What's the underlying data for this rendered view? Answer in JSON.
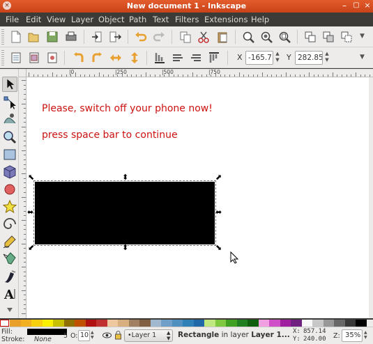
{
  "window": {
    "title": "New document 1 - Inkscape"
  },
  "menu": [
    "File",
    "Edit",
    "View",
    "Layer",
    "Object",
    "Path",
    "Text",
    "Filters",
    "Extensions",
    "Help"
  ],
  "controls": {
    "x_label": "X",
    "x_value": "-165.71",
    "y_label": "Y",
    "y_value": "282.857"
  },
  "ruler": {
    "h_labels": [
      "|0",
      "|250",
      "|500",
      "|750"
    ]
  },
  "canvas": {
    "line1": "Please, switch off your phone now!",
    "line2": "press space bar to continue",
    "text_color": "#cc1111"
  },
  "status": {
    "fill_label": "Fill:",
    "stroke_label": "Stroke:",
    "stroke_value": "None",
    "stroke_width": "5",
    "opacity_label": "O:",
    "opacity_value": "10",
    "layer": "•Layer 1",
    "message_bold": "Rectangle",
    "message_mid": " in layer ",
    "message_tail": "Layer 1...",
    "cursor_x_label": "X:",
    "cursor_x": "857.14",
    "cursor_y_label": "Y:",
    "cursor_y": "240.00",
    "zoom_label": "Z:",
    "zoom": "35%"
  },
  "palette": [
    "#e8a02a",
    "#f0b020",
    "#f8d010",
    "#f8f000",
    "#c8c000",
    "#907000",
    "#c05000",
    "#b01010",
    "#c03030",
    "#f0c8a0",
    "#d8b080",
    "#a08060",
    "#806040",
    "#a0b8d0",
    "#70a0c8",
    "#5090c0",
    "#3080b8",
    "#2068a8",
    "#c0e880",
    "#80c840",
    "#40a020",
    "#208020",
    "#106010",
    "#f0a0e0",
    "#d050c8",
    "#a020a0",
    "#702080",
    "#f8f8f8",
    "#c8c8c8",
    "#989898",
    "#686868",
    "#383838",
    "#000000"
  ]
}
